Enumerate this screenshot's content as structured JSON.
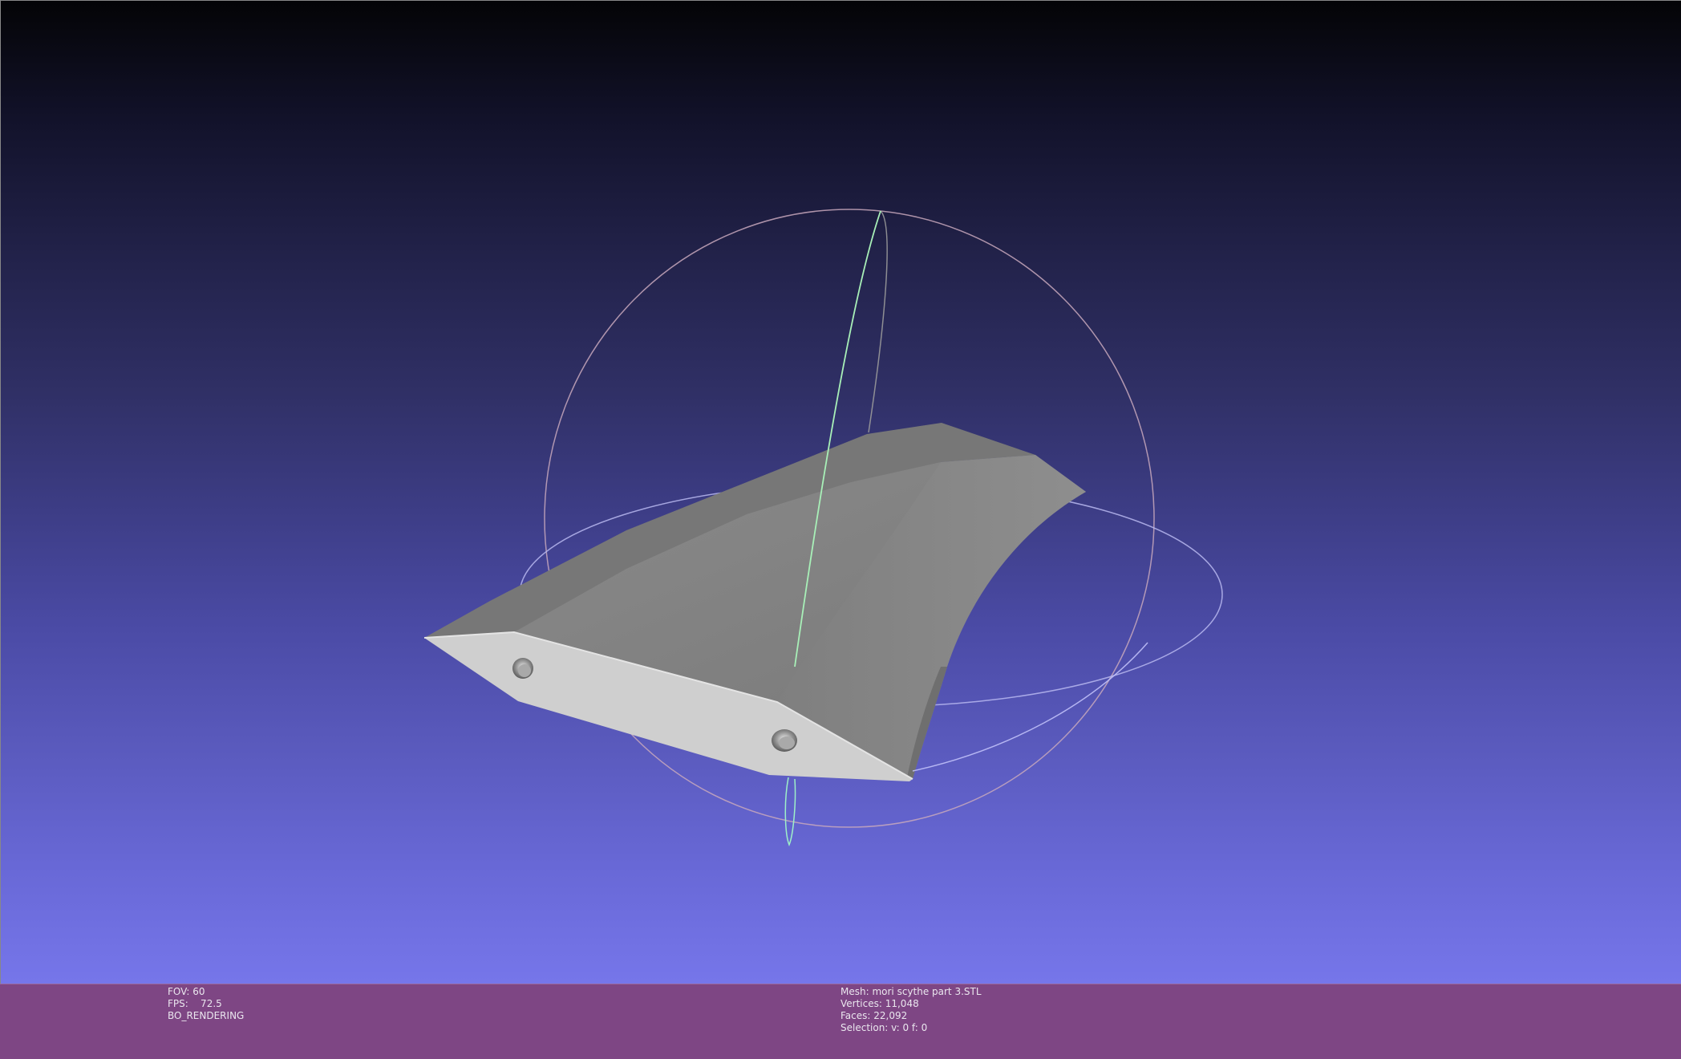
{
  "viewer": {
    "mesh_color": "#c8c8c8",
    "background_top": "#040406",
    "background_bottom": "#7676ea",
    "trackball_colors": {
      "horizontal": "#c9c9ff",
      "vertical": "#9ef0b0",
      "frontal": "#e0b0c0"
    }
  },
  "status": {
    "fov": "FOV: 60",
    "fps": "FPS:    72.5",
    "mode": "BO_RENDERING"
  },
  "mesh_info": {
    "mesh": "Mesh: mori scythe part 3.STL",
    "vertices": "Vertices: 11,048",
    "faces": "Faces: 22,092",
    "selection": "Selection: v: 0 f: 0"
  }
}
